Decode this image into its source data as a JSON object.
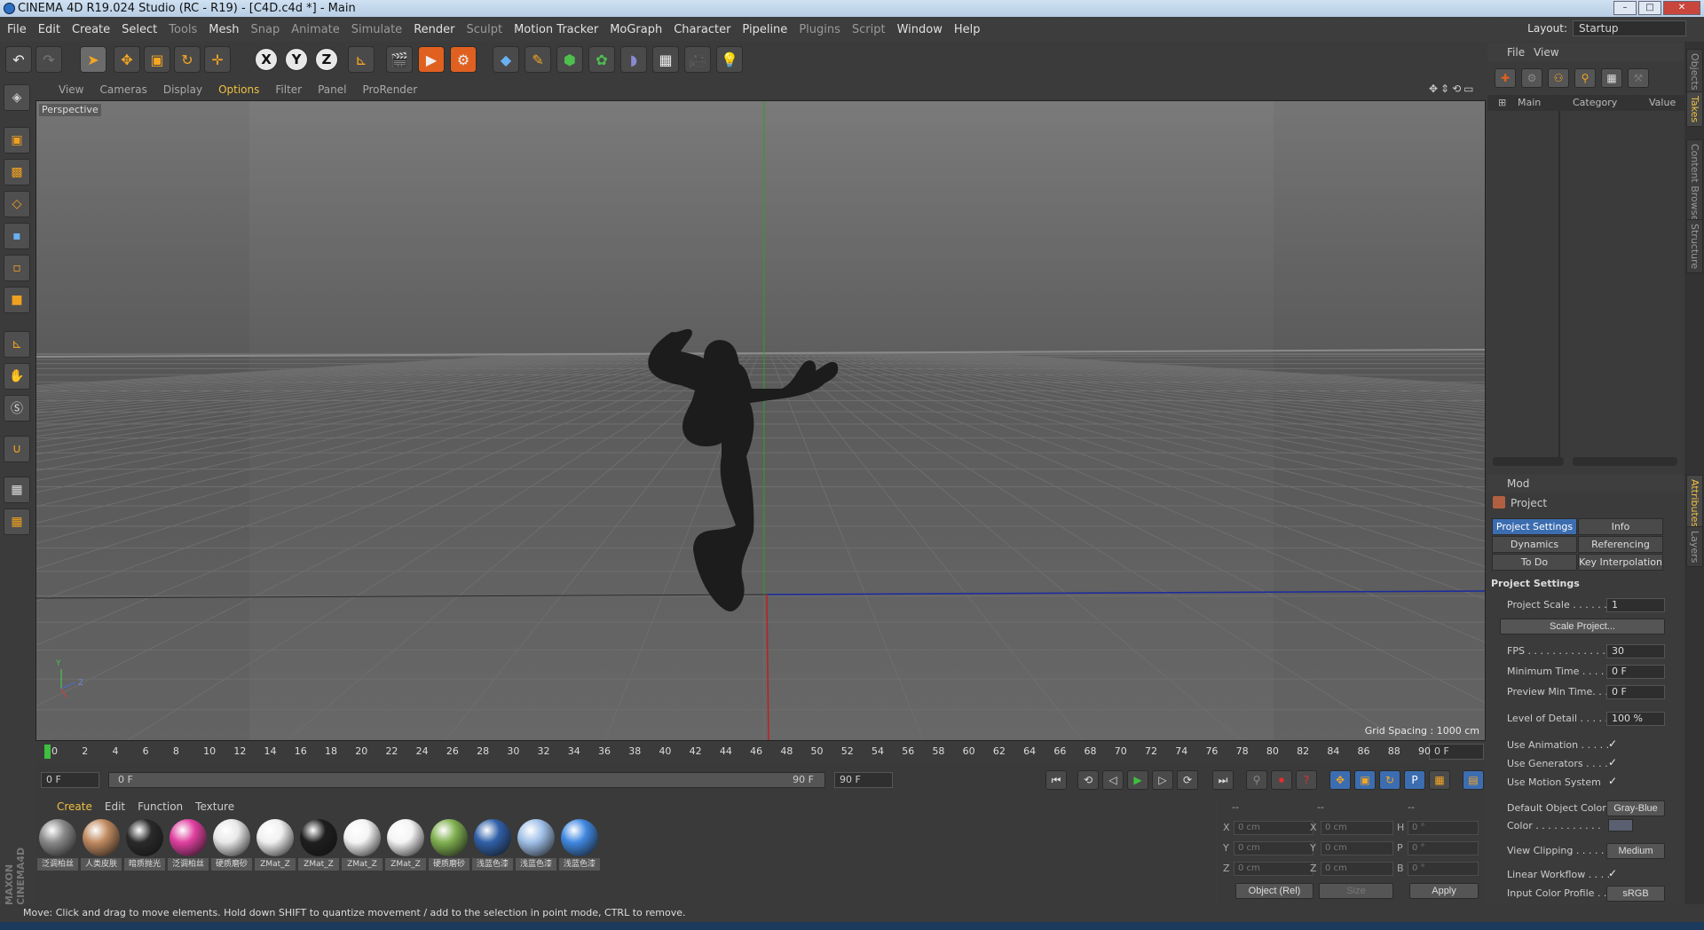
{
  "window": {
    "title": "CINEMA 4D R19.024 Studio (RC - R19) - [C4D.c4d *] - Main"
  },
  "menu": [
    "File",
    "Edit",
    "Create",
    "Select",
    "Tools",
    "Mesh",
    "Snap",
    "Animate",
    "Simulate",
    "Render",
    "Sculpt",
    "Motion Tracker",
    "MoGraph",
    "Character",
    "Pipeline",
    "Plugins",
    "Script",
    "Window",
    "Help"
  ],
  "menu_dim": [
    "Tools",
    "Snap",
    "Animate",
    "Simulate",
    "Sculpt",
    "Plugins",
    "Script"
  ],
  "layout": {
    "label": "Layout:",
    "value": "Startup"
  },
  "viewport_menu": [
    "View",
    "Cameras",
    "Display",
    "Options",
    "Filter",
    "Panel",
    "ProRender"
  ],
  "viewport": {
    "name": "Perspective",
    "grid_spacing": "Grid Spacing : 1000 cm"
  },
  "timeline": {
    "ticks": [
      "0",
      "2",
      "4",
      "6",
      "8",
      "10",
      "12",
      "14",
      "16",
      "18",
      "20",
      "22",
      "24",
      "26",
      "28",
      "30",
      "32",
      "34",
      "36",
      "38",
      "40",
      "42",
      "44",
      "46",
      "48",
      "50",
      "52",
      "54",
      "56",
      "58",
      "60",
      "62",
      "64",
      "66",
      "68",
      "70",
      "72",
      "74",
      "76",
      "78",
      "80",
      "82",
      "84",
      "86",
      "88",
      "90"
    ],
    "current": "0 F",
    "start": "0 F",
    "range_start": "0 F",
    "range_end": "90 F",
    "end": "90 F"
  },
  "material_menu": [
    "Create",
    "Edit",
    "Function",
    "Texture"
  ],
  "materials": [
    {
      "name": "泛调柏丝",
      "color": "#8a8a8a"
    },
    {
      "name": "人类皮肤",
      "color": "#c08a60"
    },
    {
      "name": "暗质抛光",
      "color": "#2a2a2a"
    },
    {
      "name": "泛调柏丝",
      "color": "#e040a0"
    },
    {
      "name": "硬质磨砂",
      "color": "#e8e8e8"
    },
    {
      "name": "ZMat_Z",
      "color": "#f0f0f0"
    },
    {
      "name": "ZMat_Z",
      "color": "#1e1e1e"
    },
    {
      "name": "ZMat_Z",
      "color": "#f4f4f4"
    },
    {
      "name": "ZMat_Z",
      "color": "#f4f4f4"
    },
    {
      "name": "硬质磨砂",
      "color": "#80b050"
    },
    {
      "name": "浅蓝色漆",
      "color": "#3060a8"
    },
    {
      "name": "浅蓝色漆",
      "color": "#a0c0e8"
    },
    {
      "name": "浅蓝色漆",
      "color": "#4088e0"
    }
  ],
  "coords": {
    "labels_col1": [
      "X",
      "Y",
      "Z"
    ],
    "labels_col2": [
      "X",
      "Y",
      "Z"
    ],
    "labels_col3": [
      "H",
      "P",
      "B"
    ],
    "pos": [
      "0 cm",
      "0 cm",
      "0 cm"
    ],
    "size": [
      "0 cm",
      "0 cm",
      "0 cm"
    ],
    "rot": [
      "0 °",
      "0 °",
      "0 °"
    ],
    "dash": "--",
    "mode": "Object (Rel)",
    "size_mode": "Size",
    "apply": "Apply"
  },
  "status": "Move: Click and drag to move elements. Hold down SHIFT to quantize movement / add to the selection in point mode, CTRL to remove.",
  "objects_panel": {
    "menu": [
      "File",
      "View"
    ],
    "cols": [
      "Main",
      "Category",
      "Value"
    ]
  },
  "attributes": {
    "mode": "Mod",
    "title": "Project",
    "tabs": [
      "Project Settings",
      "Info",
      "Dynamics",
      "Referencing",
      "To Do",
      "Key Interpolation"
    ],
    "section": "Project Settings",
    "rows": [
      {
        "label": "Project Scale . . . . . .",
        "value": "1"
      },
      {
        "label": "FPS . . . . . . . . . . . . . .",
        "value": "30"
      },
      {
        "label": "Minimum Time . . . . .",
        "value": "0 F"
      },
      {
        "label": "Preview Min Time. . .",
        "value": "0 F"
      },
      {
        "label": "Level of Detail . . . . .",
        "value": "100 %"
      }
    ],
    "scale_button": "Scale Project...",
    "checks": [
      "Use Animation . . . . .",
      "Use Generators . . . .",
      "Use Motion System"
    ],
    "check_mark": "✓",
    "default_color_label": "Default Object Color",
    "default_color_value": "Gray-Blue",
    "color_label": "Color . . . . . . . . . . .",
    "view_clipping_label": "View Clipping . . . . . .",
    "view_clipping_value": "Medium",
    "linear_label": "Linear Workflow . . . .",
    "profile_label": "Input Color Profile . . .",
    "profile_value": "sRGB"
  },
  "side_tabs": [
    "Objects",
    "Takes",
    "Content Browser",
    "Structure",
    "Attributes",
    "Layers"
  ]
}
